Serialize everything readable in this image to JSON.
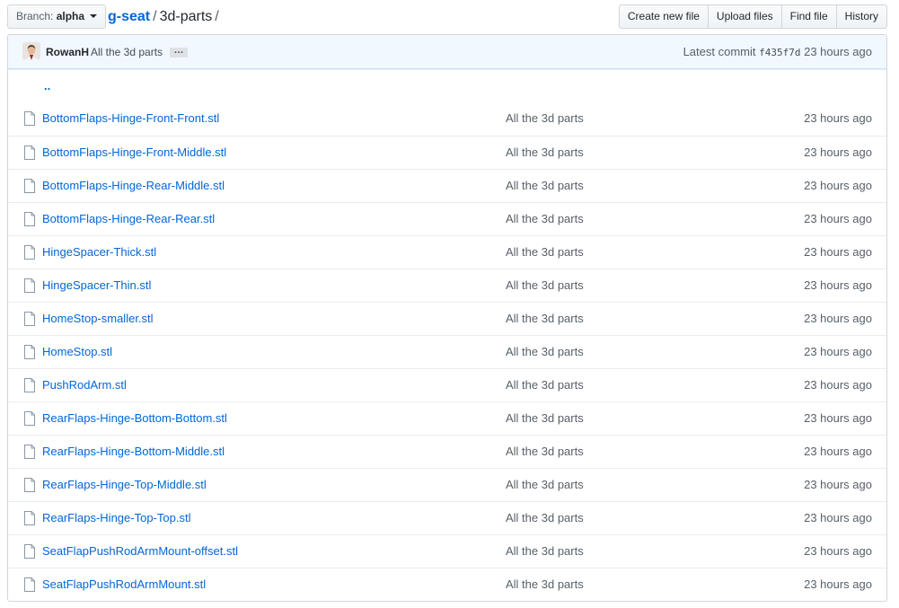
{
  "branch": {
    "label": "Branch:",
    "value": "alpha"
  },
  "breadcrumb": {
    "repo": "g-seat",
    "sep1": "/",
    "folder": "3d-parts",
    "sep2": "/"
  },
  "actions": [
    "Create new file",
    "Upload files",
    "Find file",
    "History"
  ],
  "commit": {
    "author": "RowanH",
    "message": "All the 3d parts",
    "ellipsis": "…",
    "latest_label": "Latest commit",
    "sha": "f435f7d",
    "age": "23 hours ago"
  },
  "parent_dir": "..",
  "files": [
    {
      "name": "BottomFlaps-Hinge-Front-Front.stl",
      "message": "All the 3d parts",
      "age": "23 hours ago"
    },
    {
      "name": "BottomFlaps-Hinge-Front-Middle.stl",
      "message": "All the 3d parts",
      "age": "23 hours ago"
    },
    {
      "name": "BottomFlaps-Hinge-Rear-Middle.stl",
      "message": "All the 3d parts",
      "age": "23 hours ago"
    },
    {
      "name": "BottomFlaps-Hinge-Rear-Rear.stl",
      "message": "All the 3d parts",
      "age": "23 hours ago"
    },
    {
      "name": "HingeSpacer-Thick.stl",
      "message": "All the 3d parts",
      "age": "23 hours ago"
    },
    {
      "name": "HingeSpacer-Thin.stl",
      "message": "All the 3d parts",
      "age": "23 hours ago"
    },
    {
      "name": "HomeStop-smaller.stl",
      "message": "All the 3d parts",
      "age": "23 hours ago"
    },
    {
      "name": "HomeStop.stl",
      "message": "All the 3d parts",
      "age": "23 hours ago"
    },
    {
      "name": "PushRodArm.stl",
      "message": "All the 3d parts",
      "age": "23 hours ago"
    },
    {
      "name": "RearFlaps-Hinge-Bottom-Bottom.stl",
      "message": "All the 3d parts",
      "age": "23 hours ago"
    },
    {
      "name": "RearFlaps-Hinge-Bottom-Middle.stl",
      "message": "All the 3d parts",
      "age": "23 hours ago"
    },
    {
      "name": "RearFlaps-Hinge-Top-Middle.stl",
      "message": "All the 3d parts",
      "age": "23 hours ago"
    },
    {
      "name": "RearFlaps-Hinge-Top-Top.stl",
      "message": "All the 3d parts",
      "age": "23 hours ago"
    },
    {
      "name": "SeatFlapPushRodArmMount-offset.stl",
      "message": "All the 3d parts",
      "age": "23 hours ago"
    },
    {
      "name": "SeatFlapPushRodArmMount.stl",
      "message": "All the 3d parts",
      "age": "23 hours ago"
    }
  ],
  "icons": {
    "file": "file-icon",
    "avatar": "user-avatar",
    "caret": "caret-down-icon"
  }
}
